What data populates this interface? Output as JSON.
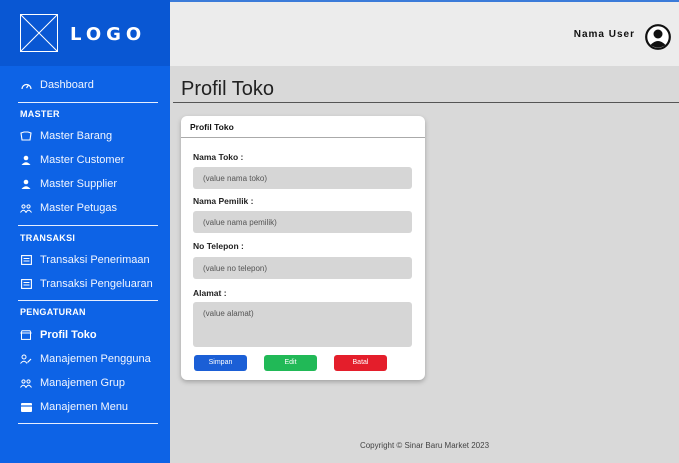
{
  "logo": {
    "text": "LOGO"
  },
  "header": {
    "user_name": "Nama User"
  },
  "sidebar": {
    "dashboard": "Dashboard",
    "sections": {
      "master": "MASTER",
      "transaksi": "TRANSAKSI",
      "pengaturan": "PENGATURAN"
    },
    "items": {
      "master_barang": "Master Barang",
      "master_customer": "Master Customer",
      "master_supplier": "Master Supplier",
      "master_petugas": "Master Petugas",
      "transaksi_penerimaan": "Transaksi Penerimaan",
      "transaksi_pengeluaran": "Transaksi Pengeluaran",
      "profil_toko": "Profil Toko",
      "manajemen_pengguna": "Manajemen Pengguna",
      "manajemen_grup": "Manajemen Grup",
      "manajemen_menu": "Manajemen Menu"
    },
    "active": "profil_toko"
  },
  "main": {
    "page_title": "Profil Toko",
    "card": {
      "title": "Profil Toko",
      "fields": {
        "nama_toko": {
          "label": "Nama Toko :",
          "value": "(value nama toko)"
        },
        "nama_pemilik": {
          "label": "Nama Pemilik :",
          "value": "(value nama pemilik)"
        },
        "no_telepon": {
          "label": "No Telepon :",
          "value": "(value no telepon)"
        },
        "alamat": {
          "label": "Alamat :",
          "value": "(value alamat)"
        }
      },
      "buttons": {
        "simpan": "Simpan",
        "edit": "Edit",
        "batal": "Batal"
      }
    }
  },
  "footer": {
    "copyright": "Copyright © Sinar Baru Market 2023"
  },
  "colors": {
    "sidebar": "#0d63e6",
    "btn_simpan": "#1b5fd6",
    "btn_edit": "#21b957",
    "btn_batal": "#e41e2b"
  }
}
